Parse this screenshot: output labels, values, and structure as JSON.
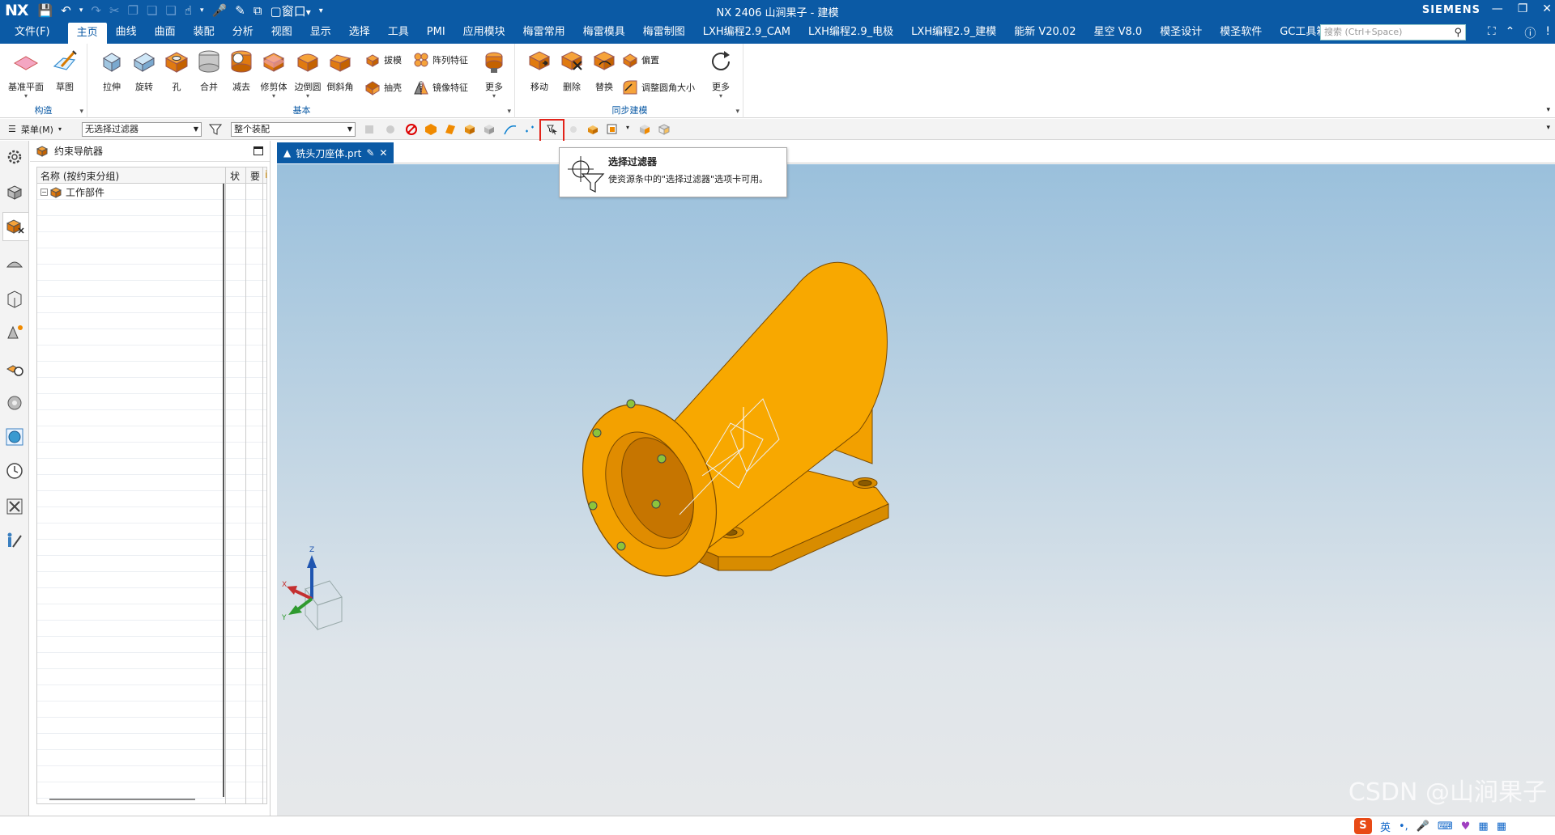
{
  "app": {
    "logo": "NX",
    "title": "NX 2406 山涧果子 - 建模",
    "brand": "SIEMENS",
    "window_menu_label": "窗口"
  },
  "menubar": {
    "file": "文件(F)",
    "tabs": [
      "主页",
      "曲线",
      "曲面",
      "装配",
      "分析",
      "视图",
      "显示",
      "选择",
      "工具",
      "PMI",
      "应用模块",
      "梅雷常用",
      "梅雷模具",
      "梅雷制图",
      "LXH编程2.9_CAM",
      "LXH编程2.9_电极",
      "LXH编程2.9_建模",
      "能新 V20.02",
      "星空 V8.0",
      "模圣设计",
      "模圣软件",
      "GC工具箱"
    ],
    "active_tab": "主页",
    "search_placeholder": "搜索 (Ctrl+Space)"
  },
  "ribbon": {
    "groups": {
      "construct": "构造",
      "basic": "基本",
      "sync": "同步建模"
    },
    "construct_tools": [
      "基准平面",
      "草图"
    ],
    "basic_tools": [
      "拉伸",
      "旋转",
      "孔",
      "合并",
      "减去",
      "修剪体",
      "边倒圆",
      "倒斜角"
    ],
    "basic_small": [
      "拔模",
      "阵列特征",
      "抽壳",
      "镜像特征"
    ],
    "basic_more": "更多",
    "sync_tools": [
      "移动",
      "删除",
      "替换"
    ],
    "sync_small": [
      "偏置",
      "调整圆角大小"
    ],
    "sync_more": "更多"
  },
  "selbar": {
    "menu": "菜单(M)",
    "filter": "无选择过滤器",
    "scope": "整个装配"
  },
  "navigator": {
    "title": "约束导航器",
    "col_name": "名称 (按约束分组)",
    "col_status": "状",
    "col_req": "要",
    "col_info": "i",
    "root_item": "工作部件"
  },
  "document": {
    "tab": "铣头刀座体.prt"
  },
  "tooltip": {
    "title": "选择过滤器",
    "body": "使资源条中的\"选择过滤器\"选项卡可用。"
  },
  "triad": {
    "x": "X",
    "y": "Y",
    "z": "Z"
  },
  "watermark": "CSDN @山涧果子",
  "ime": {
    "lang": "英",
    "logo": "S"
  },
  "colors": {
    "nx_blue": "#0b5aa5",
    "part_orange": "#f5a000",
    "highlight_red": "#e2231a"
  }
}
